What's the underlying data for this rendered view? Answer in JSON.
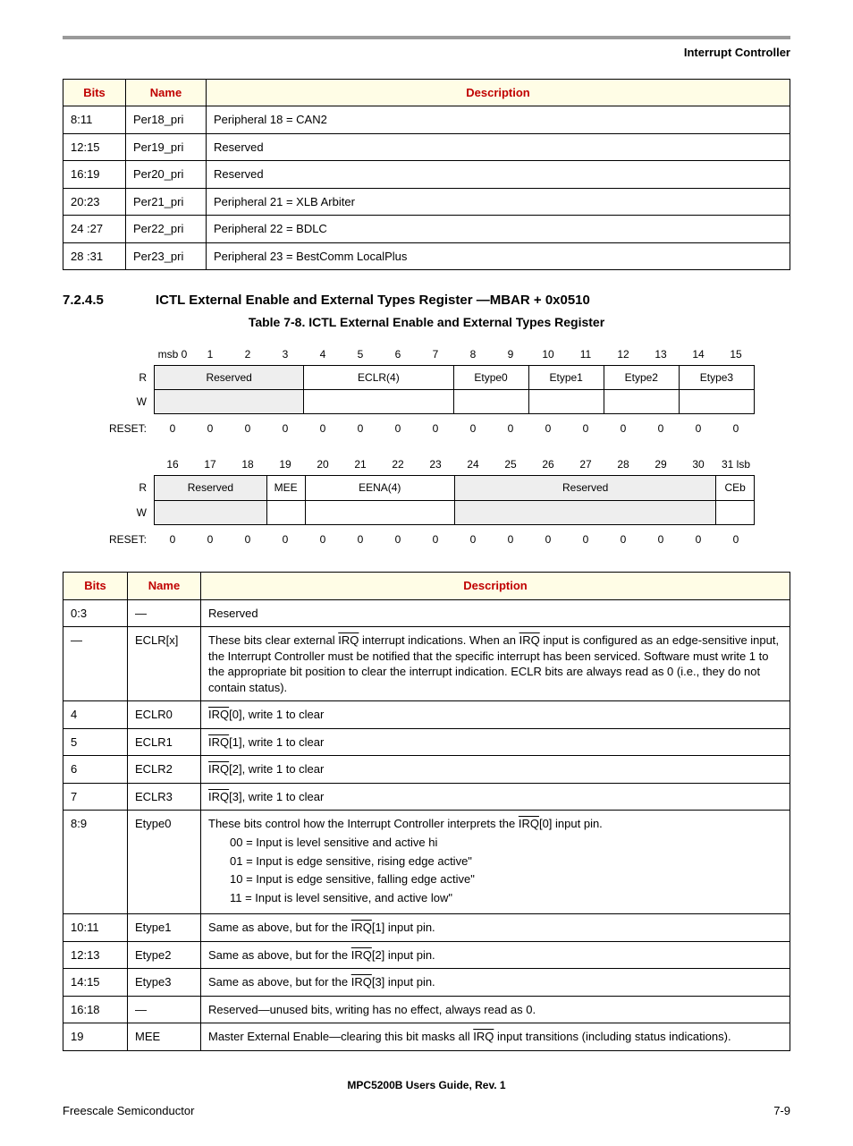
{
  "header": {
    "section": "Interrupt Controller"
  },
  "table1": {
    "headers": {
      "bits": "Bits",
      "name": "Name",
      "desc": "Description"
    },
    "rows": [
      {
        "bits": "8:11",
        "name": "Per18_pri",
        "desc": "Peripheral 18 = CAN2"
      },
      {
        "bits": "12:15",
        "name": "Per19_pri",
        "desc": "Reserved"
      },
      {
        "bits": "16:19",
        "name": "Per20_pri",
        "desc": "Reserved"
      },
      {
        "bits": "20:23",
        "name": "Per21_pri",
        "desc": "Peripheral 21 = XLB Arbiter"
      },
      {
        "bits": "24 :27",
        "name": "Per22_pri",
        "desc": "Peripheral 22 = BDLC"
      },
      {
        "bits": "28 :31",
        "name": "Per23_pri",
        "desc": "Peripheral 23 = BestComm LocalPlus"
      }
    ]
  },
  "section": {
    "num": "7.2.4.5",
    "title": "ICTL External Enable and External Types Register —MBAR + 0x0510",
    "caption": "Table 7-8. ICTL External Enable and External Types Register"
  },
  "bits_hi": {
    "nums": [
      "msb 0",
      "1",
      "2",
      "3",
      "4",
      "5",
      "6",
      "7",
      "8",
      "9",
      "10",
      "11",
      "12",
      "13",
      "14",
      "15"
    ],
    "r": "R",
    "w": "W",
    "fields": [
      {
        "label": "Reserved",
        "span": 4,
        "shade": true
      },
      {
        "label": "ECLR(4)",
        "span": 4
      },
      {
        "label": "Etype0",
        "span": 2
      },
      {
        "label": "Etype1",
        "span": 2
      },
      {
        "label": "Etype2",
        "span": 2
      },
      {
        "label": "Etype3",
        "span": 2
      }
    ],
    "reset_label": "RESET:",
    "reset": [
      "0",
      "0",
      "0",
      "0",
      "0",
      "0",
      "0",
      "0",
      "0",
      "0",
      "0",
      "0",
      "0",
      "0",
      "0",
      "0"
    ]
  },
  "bits_lo": {
    "nums": [
      "16",
      "17",
      "18",
      "19",
      "20",
      "21",
      "22",
      "23",
      "24",
      "25",
      "26",
      "27",
      "28",
      "29",
      "30",
      "31 lsb"
    ],
    "r": "R",
    "w": "W",
    "fields": [
      {
        "label": "Reserved",
        "span": 3,
        "shade": true
      },
      {
        "label": "MEE",
        "span": 1
      },
      {
        "label": "EENA(4)",
        "span": 4
      },
      {
        "label": "Reserved",
        "span": 7,
        "shade": true
      },
      {
        "label": "CEb",
        "span": 1
      }
    ],
    "reset_label": "RESET:",
    "reset": [
      "0",
      "0",
      "0",
      "0",
      "0",
      "0",
      "0",
      "0",
      "0",
      "0",
      "0",
      "0",
      "0",
      "0",
      "0",
      "0"
    ]
  },
  "table2": {
    "headers": {
      "bits": "Bits",
      "name": "Name",
      "desc": "Description"
    },
    "rows": [
      {
        "bits": "0:3",
        "name": "—",
        "desc_plain": "Reserved"
      },
      {
        "bits": "—",
        "name": "ECLR[x]",
        "desc_irq_intro": true,
        "p1a": "These bits clear external ",
        "p1b": " interrupt indications. When an ",
        "p1c": " input is configured as an edge-sensitive input, the Interrupt Controller must be notified that the specific interrupt has been serviced. Software must write 1 to the appropriate bit position to clear the interrupt indication. ECLR bits are always read as 0 (i.e., they do not contain status)."
      },
      {
        "bits": "4",
        "name": "ECLR0",
        "desc_irq_n": "0",
        "desc_tail": ", write 1 to clear"
      },
      {
        "bits": "5",
        "name": "ECLR1",
        "desc_irq_n": "1",
        "desc_tail": ", write 1 to clear"
      },
      {
        "bits": "6",
        "name": "ECLR2",
        "desc_irq_n": "2",
        "desc_tail": ", write 1 to clear"
      },
      {
        "bits": "7",
        "name": "ECLR3",
        "desc_irq_n": "3",
        "desc_tail": ", write 1 to clear"
      },
      {
        "bits": "8:9",
        "name": "Etype0",
        "desc_etype0": true,
        "lead_a": "These bits control how the Interrupt Controller interprets the ",
        "lead_b": "[0] input pin.",
        "opt00": "00 = Input is level sensitive and active hi",
        "opt01": "01 = Input is edge sensitive, rising edge active\"",
        "opt10": "10 = Input is edge sensitive, falling edge active\"",
        "opt11": "11 = Input is level sensitive, and active low\""
      },
      {
        "bits": "10:11",
        "name": "Etype1",
        "desc_same_n": "1"
      },
      {
        "bits": "12:13",
        "name": "Etype2",
        "desc_same_n": "2"
      },
      {
        "bits": "14:15",
        "name": "Etype3",
        "desc_same_n": "3"
      },
      {
        "bits": "16:18",
        "name": "—",
        "desc_plain": "Reserved—unused bits, writing has no effect, always read as 0."
      },
      {
        "bits": "19",
        "name": "MEE",
        "desc_mee": true,
        "ma": "Master External Enable—clearing this bit masks all ",
        "mb": " input transitions (including status indications)."
      }
    ],
    "irq": "IRQ",
    "same_a": "Same as above, but for the ",
    "same_b": "] input pin."
  },
  "footer": {
    "center": "MPC5200B Users Guide, Rev. 1",
    "left": "Freescale Semiconductor",
    "right": "7-9"
  }
}
